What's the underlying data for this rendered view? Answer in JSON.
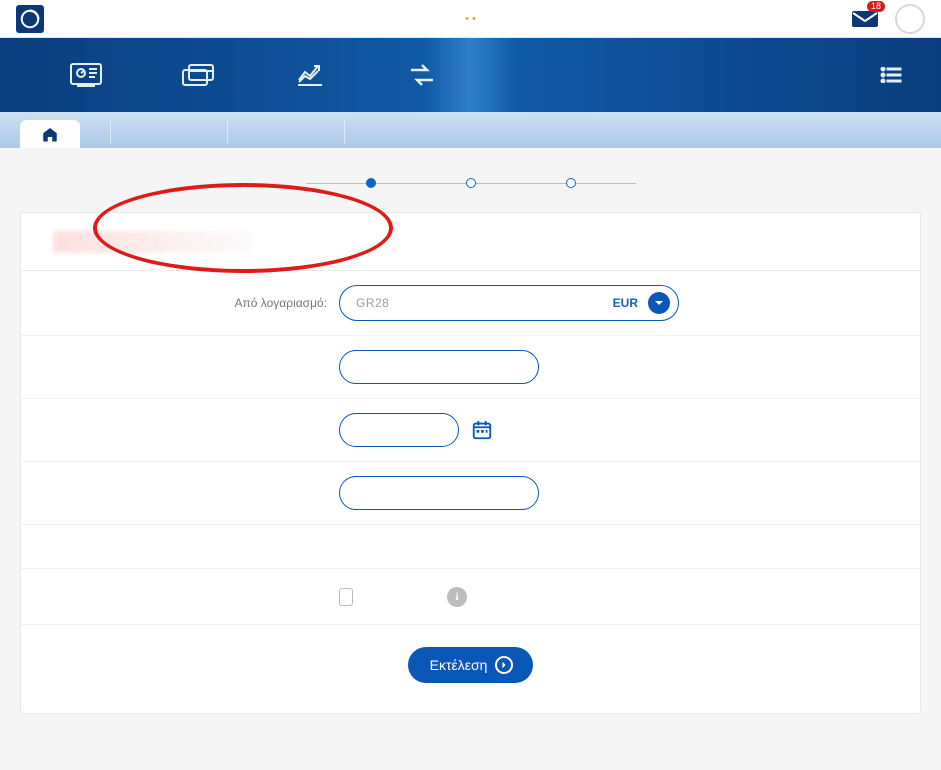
{
  "header": {
    "mail_count": "18"
  },
  "form": {
    "from_account_label": "Από λογαριασμό:",
    "account_prefix": "GR28",
    "currency": "EUR"
  },
  "submit": {
    "label": "Εκτέλεση"
  },
  "stepper": {
    "active_index": 0,
    "total": 3
  }
}
